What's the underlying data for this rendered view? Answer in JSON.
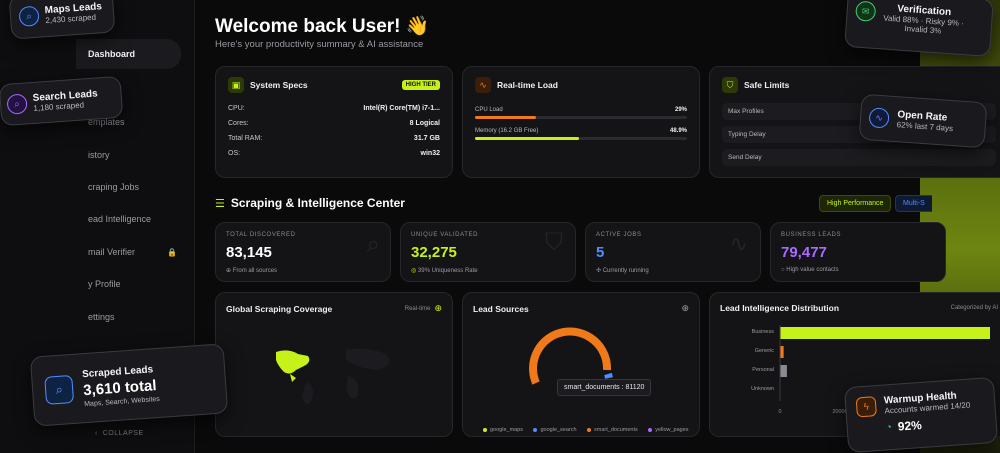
{
  "sidebar": {
    "items": [
      {
        "label": "Dashboard",
        "active": true
      },
      {
        "label": "emplates"
      },
      {
        "label": "istory"
      },
      {
        "label": "craping Jobs"
      },
      {
        "label": "ead Intelligence"
      },
      {
        "label": "mail Verifier"
      },
      {
        "label": "y Profile"
      },
      {
        "label": "ettings"
      }
    ],
    "collapse_label": "COLLAPSE"
  },
  "header": {
    "title": "Welcome back User! 👋",
    "subtitle": "Here's your productivity summary & AI assistance"
  },
  "system_specs": {
    "title": "System Specs",
    "badge": "HIGH TIER",
    "rows": [
      {
        "label": "CPU:",
        "value": "Intel(R) Core(TM) i7-1..."
      },
      {
        "label": "Cores:",
        "value": "8 Logical"
      },
      {
        "label": "Total RAM:",
        "value": "31.7 GB"
      },
      {
        "label": "OS:",
        "value": "win32"
      }
    ]
  },
  "realtime_load": {
    "title": "Real-time Load",
    "cpu_label": "CPU Load",
    "cpu_value": "29%",
    "cpu_fraction": 0.29,
    "mem_label": "Memory (16.2 GB Free)",
    "mem_value": "48.9%",
    "mem_fraction": 0.489
  },
  "safe_limits": {
    "title": "Safe Limits",
    "rows": [
      "Max Profiles",
      "Typing Delay",
      "Send Delay"
    ]
  },
  "section": {
    "title": "Scraping & Intelligence Center",
    "pill_high": "High Performance",
    "pill_multi": "Multi-S"
  },
  "stats": [
    {
      "label": "TOTAL DISCOVERED",
      "value": "83,145",
      "sub": "From all sources",
      "color": "#ffffff"
    },
    {
      "label": "UNIQUE VALIDATED",
      "value": "32,275",
      "sub": "39% Uniqueness Rate",
      "color": "#c6f21a"
    },
    {
      "label": "ACTIVE JOBS",
      "value": "5",
      "sub": "Currently running",
      "color": "#4f8dff"
    },
    {
      "label": "BUSINESS LEADS",
      "value": "79,477",
      "sub": "High value contacts",
      "color": "#a86bff"
    }
  ],
  "coverage": {
    "title": "Global Scraping Coverage",
    "tag": "Real-time"
  },
  "lead_sources": {
    "title": "Lead Sources",
    "tooltip": "smart_documents : 81120",
    "legend": [
      {
        "name": "google_maps",
        "color": "#c6f21a"
      },
      {
        "name": "google_search",
        "color": "#4f8dff"
      },
      {
        "name": "smart_documents",
        "color": "#f07a1a"
      },
      {
        "name": "yellow_pages",
        "color": "#a86bff"
      }
    ]
  },
  "distribution": {
    "title": "Lead Intelligence Distribution",
    "tag": "Categorized by AI",
    "chart_data": {
      "type": "bar",
      "categories": [
        "Business",
        "Generic",
        "Personal",
        "Unknown"
      ],
      "values": [
        79477,
        1200,
        2300,
        0
      ],
      "xticks": [
        "0",
        "20000"
      ]
    }
  },
  "floats": {
    "maps": {
      "title": "Maps Leads",
      "sub": "2,430 scraped"
    },
    "search": {
      "title": "Search Leads",
      "sub": "1,180 scraped"
    },
    "scraped": {
      "title": "Scraped Leads",
      "total": "3,610 total",
      "sub": "Maps, Search, Websites"
    },
    "verification": {
      "title": "Verification",
      "sub1": "Valid 88% · Risky 9% ·",
      "sub2": "Invalid 3%"
    },
    "open_rate": {
      "title": "Open Rate",
      "sub": "62% last 7 days"
    },
    "warmup": {
      "title": "Warmup Health",
      "sub": "Accounts warmed 14/20",
      "value": "92%"
    }
  }
}
